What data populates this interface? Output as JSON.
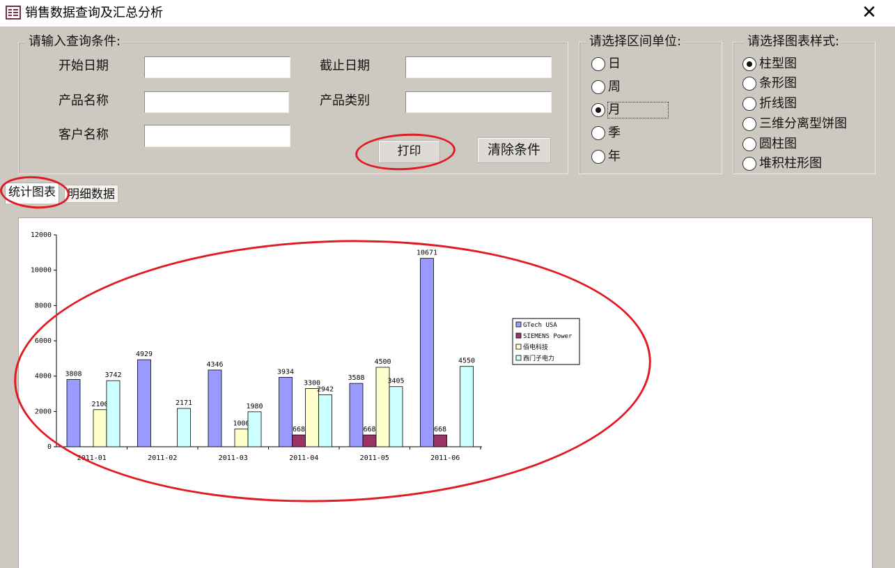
{
  "window": {
    "title": "销售数据查询及汇总分析",
    "close_glyph": "✕"
  },
  "query": {
    "legend": "请输入查询条件:",
    "start_date_label": "开始日期",
    "end_date_label": "截止日期",
    "product_name_label": "产品名称",
    "product_category_label": "产品类别",
    "customer_name_label": "客户名称",
    "start_date_value": "",
    "end_date_value": "",
    "product_name_value": "",
    "product_category_value": "",
    "customer_name_value": "",
    "print_label": "打印",
    "clear_label": "清除条件"
  },
  "interval": {
    "legend": "请选择区间单位:",
    "options": [
      "日",
      "周",
      "月",
      "季",
      "年"
    ],
    "selected": "月"
  },
  "chart_style": {
    "legend": "请选择图表样式:",
    "options": [
      "柱型图",
      "条形图",
      "折线图",
      "三维分离型饼图",
      "圆柱图",
      "堆积柱形图"
    ],
    "selected": "柱型图"
  },
  "tabs": [
    {
      "label": "统计图表",
      "active": true
    },
    {
      "label": "明细数据",
      "active": false
    }
  ],
  "icons": {
    "app": "form-icon",
    "close": "close-icon"
  },
  "colors": {
    "annotation": "#e01b24",
    "series": [
      "#9999ff",
      "#993366",
      "#ffffcc",
      "#ccffff"
    ]
  },
  "chart_data": {
    "type": "bar",
    "categories": [
      "2011-01",
      "2011-02",
      "2011-03",
      "2011-04",
      "2011-05",
      "2011-06"
    ],
    "ylim": [
      0,
      12000
    ],
    "yticks": [
      0,
      2000,
      4000,
      6000,
      8000,
      10000,
      12000
    ],
    "legend_position": "right",
    "series": [
      {
        "name": "GTech USA",
        "values": [
          3808,
          4929,
          4346,
          3934,
          3588,
          10671
        ]
      },
      {
        "name": "SIEMENS Power",
        "values": [
          null,
          null,
          null,
          668,
          668,
          668
        ]
      },
      {
        "name": "佰电科技",
        "values": [
          2100,
          null,
          1000,
          3300,
          4500,
          null
        ]
      },
      {
        "name": "西门子电力",
        "values": [
          3742,
          2171,
          1980,
          2942,
          3405,
          4550
        ]
      }
    ]
  }
}
